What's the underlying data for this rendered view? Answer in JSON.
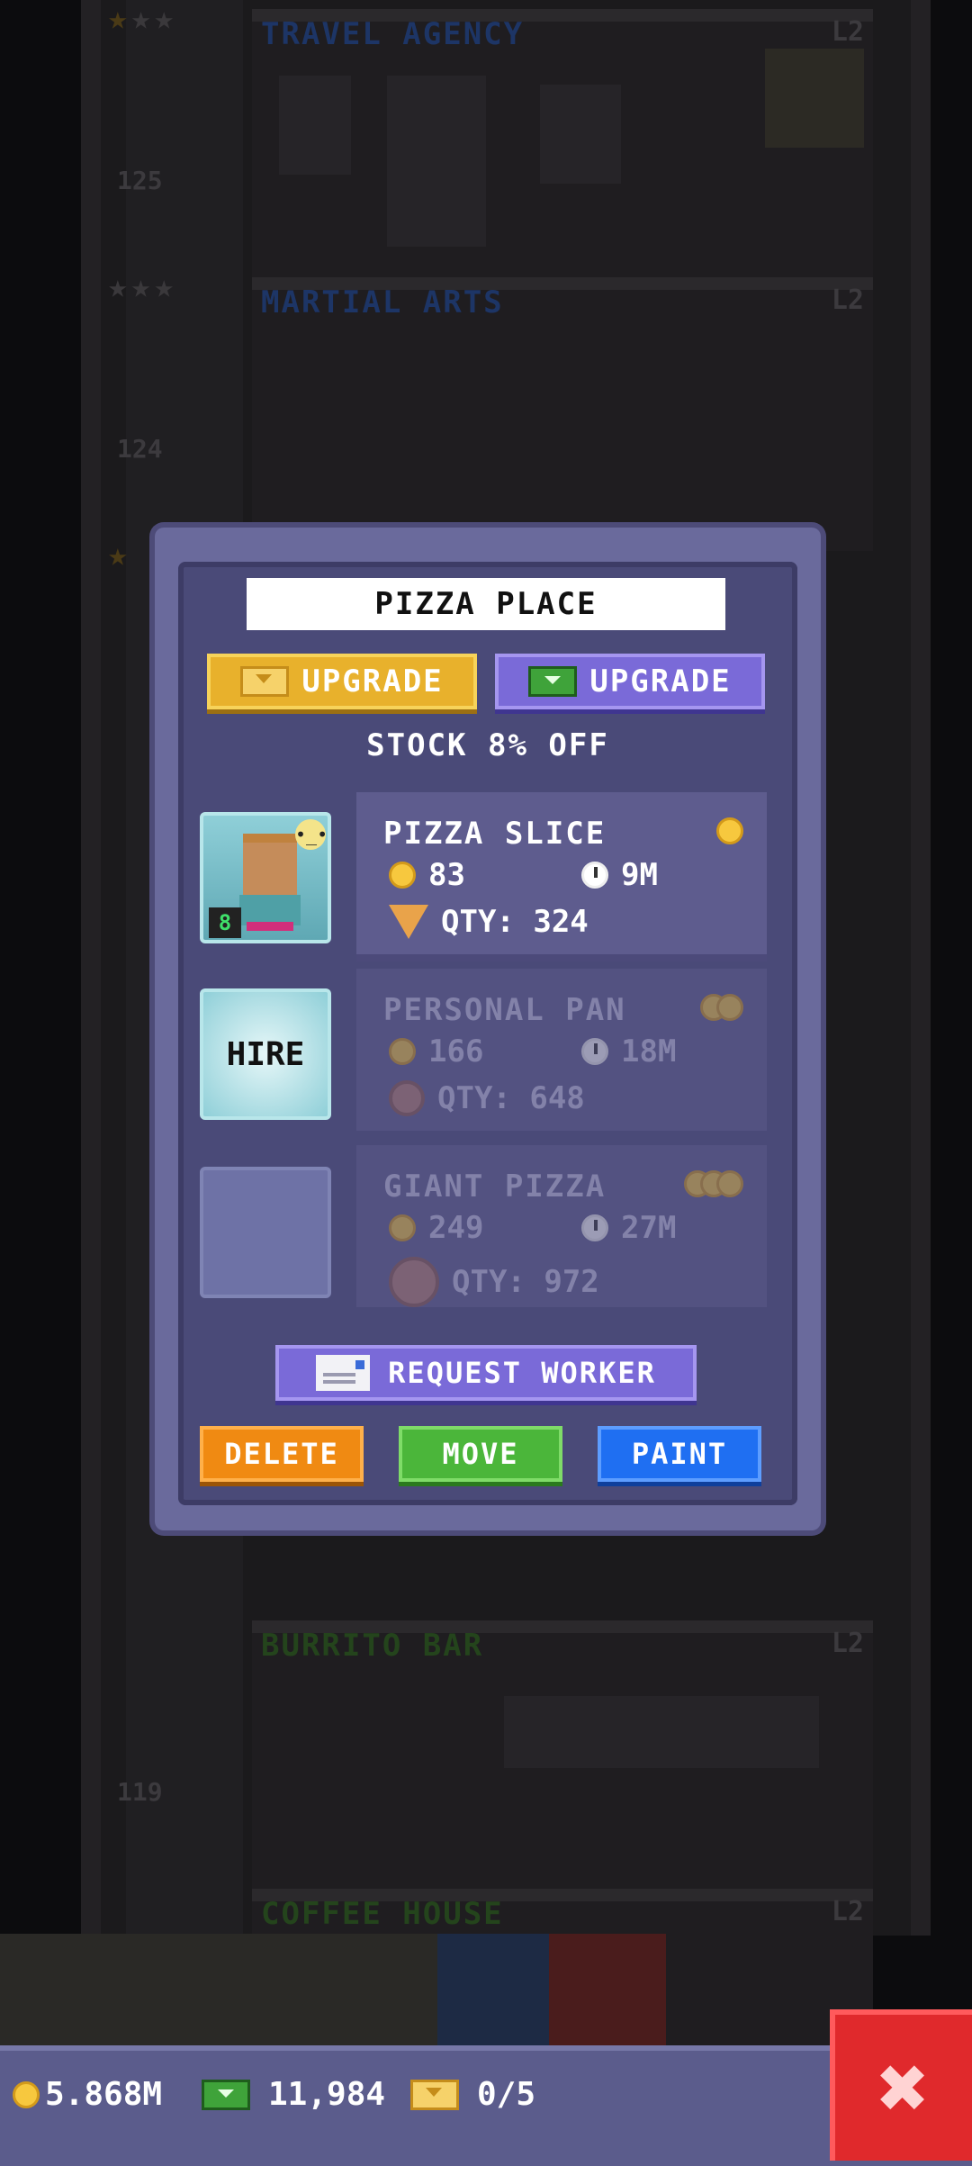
{
  "background": {
    "floors": [
      {
        "name": "TRAVEL AGENCY",
        "level": "L2",
        "number": "125",
        "color": "#1c2f5a"
      },
      {
        "name": "MARTIAL ARTS",
        "level": "L2",
        "number": "124",
        "color": "#1c2f5a"
      },
      {
        "name": "BURRITO BAR",
        "level": "L2",
        "number": "119",
        "color": "#1f3a18"
      },
      {
        "name": "COFFEE HOUSE",
        "level": "L2",
        "number": "",
        "color": "#1f3a18"
      }
    ]
  },
  "modal": {
    "title": "PIZZA PLACE",
    "upgrade_coins_label": "UPGRADE",
    "upgrade_bux_label": "UPGRADE",
    "stock_text": "STOCK 8% OFF",
    "worker_level": "8",
    "hire_label": "HIRE",
    "products": [
      {
        "name": "PIZZA SLICE",
        "cost": "83",
        "time": "9M",
        "qty": "QTY: 324",
        "tier_coins": 1
      },
      {
        "name": "PERSONAL PAN",
        "cost": "166",
        "time": "18M",
        "qty": "QTY: 648",
        "tier_coins": 2
      },
      {
        "name": "GIANT PIZZA",
        "cost": "249",
        "time": "27M",
        "qty": "QTY: 972",
        "tier_coins": 3
      }
    ],
    "request_worker_label": "REQUEST WORKER",
    "delete_label": "DELETE",
    "move_label": "MOVE",
    "paint_label": "PAINT"
  },
  "hud": {
    "coins": "5.868M",
    "bux": "11,984",
    "tickets": "0/5",
    "close_icon": "close-icon"
  },
  "colors": {
    "modal_bg": "#4a4a78",
    "gold": "#e8b12c",
    "purple": "#7a6ad8",
    "delete": "#f08a12",
    "move": "#4bb63a",
    "paint": "#1f6ff2",
    "close": "#e0292c"
  }
}
